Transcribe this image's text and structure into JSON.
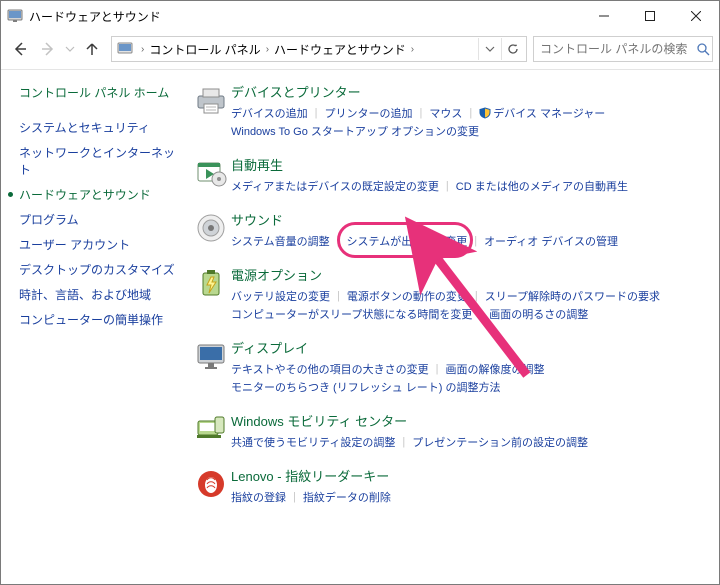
{
  "window": {
    "title": "ハードウェアとサウンド",
    "buttons": {
      "minimize": "—",
      "maximize": "▢",
      "close": "✕"
    }
  },
  "toolbar": {
    "breadcrumb": {
      "root": "コントロール パネル",
      "current": "ハードウェアとサウンド"
    },
    "search": {
      "placeholder": "コントロール パネルの検索"
    }
  },
  "sidebar": {
    "home": "コントロール パネル ホーム",
    "items": [
      {
        "label": "システムとセキュリティ",
        "active": false
      },
      {
        "label": "ネットワークとインターネット",
        "active": false
      },
      {
        "label": "ハードウェアとサウンド",
        "active": true
      },
      {
        "label": "プログラム",
        "active": false
      },
      {
        "label": "ユーザー アカウント",
        "active": false
      },
      {
        "label": "デスクトップのカスタマイズ",
        "active": false
      },
      {
        "label": "時計、言語、および地域",
        "active": false
      },
      {
        "label": "コンピューターの簡単操作",
        "active": false
      }
    ]
  },
  "sections": [
    {
      "id": "devices",
      "icon": "printer-devices-icon",
      "title": "デバイスとプリンター",
      "rows": [
        [
          "デバイスの追加",
          "プリンターの追加",
          "マウス",
          {
            "label": "デバイス マネージャー",
            "shield": true
          }
        ],
        [
          "Windows To Go スタートアップ オプションの変更"
        ]
      ]
    },
    {
      "id": "autoplay",
      "icon": "autoplay-icon",
      "title": "自動再生",
      "rows": [
        [
          "メディアまたはデバイスの既定設定の変更",
          "CD または他のメディアの自動再生"
        ]
      ]
    },
    {
      "id": "sound",
      "icon": "speaker-icon",
      "title": "サウンド",
      "rows": [
        [
          "システム音量の調整",
          "システムが出す音の変更",
          "オーディオ デバイスの管理"
        ]
      ]
    },
    {
      "id": "power",
      "icon": "battery-icon",
      "title": "電源オプション",
      "rows": [
        [
          "バッテリ設定の変更",
          "電源ボタンの動作の変更",
          "スリープ解除時のパスワードの要求"
        ],
        [
          "コンピューターがスリープ状態になる時間を変更",
          "画面の明るさの調整"
        ]
      ]
    },
    {
      "id": "display",
      "icon": "monitor-icon",
      "title": "ディスプレイ",
      "rows": [
        [
          "テキストやその他の項目の大きさの変更",
          "画面の解像度の調整"
        ],
        [
          "モニターのちらつき (リフレッシュ レート) の調整方法"
        ]
      ]
    },
    {
      "id": "mobility",
      "icon": "mobility-icon",
      "title": "Windows モビリティ センター",
      "rows": [
        [
          "共通で使うモビリティ設定の調整",
          "プレゼンテーション前の設定の調整"
        ]
      ]
    },
    {
      "id": "lenovo",
      "icon": "fingerprint-icon",
      "title": "Lenovo - 指紋リーダーキー",
      "rows": [
        [
          "指紋の登録",
          "指紋データの削除"
        ]
      ]
    }
  ],
  "annotation": {
    "highlight_target": "システムが出す音の変更"
  }
}
